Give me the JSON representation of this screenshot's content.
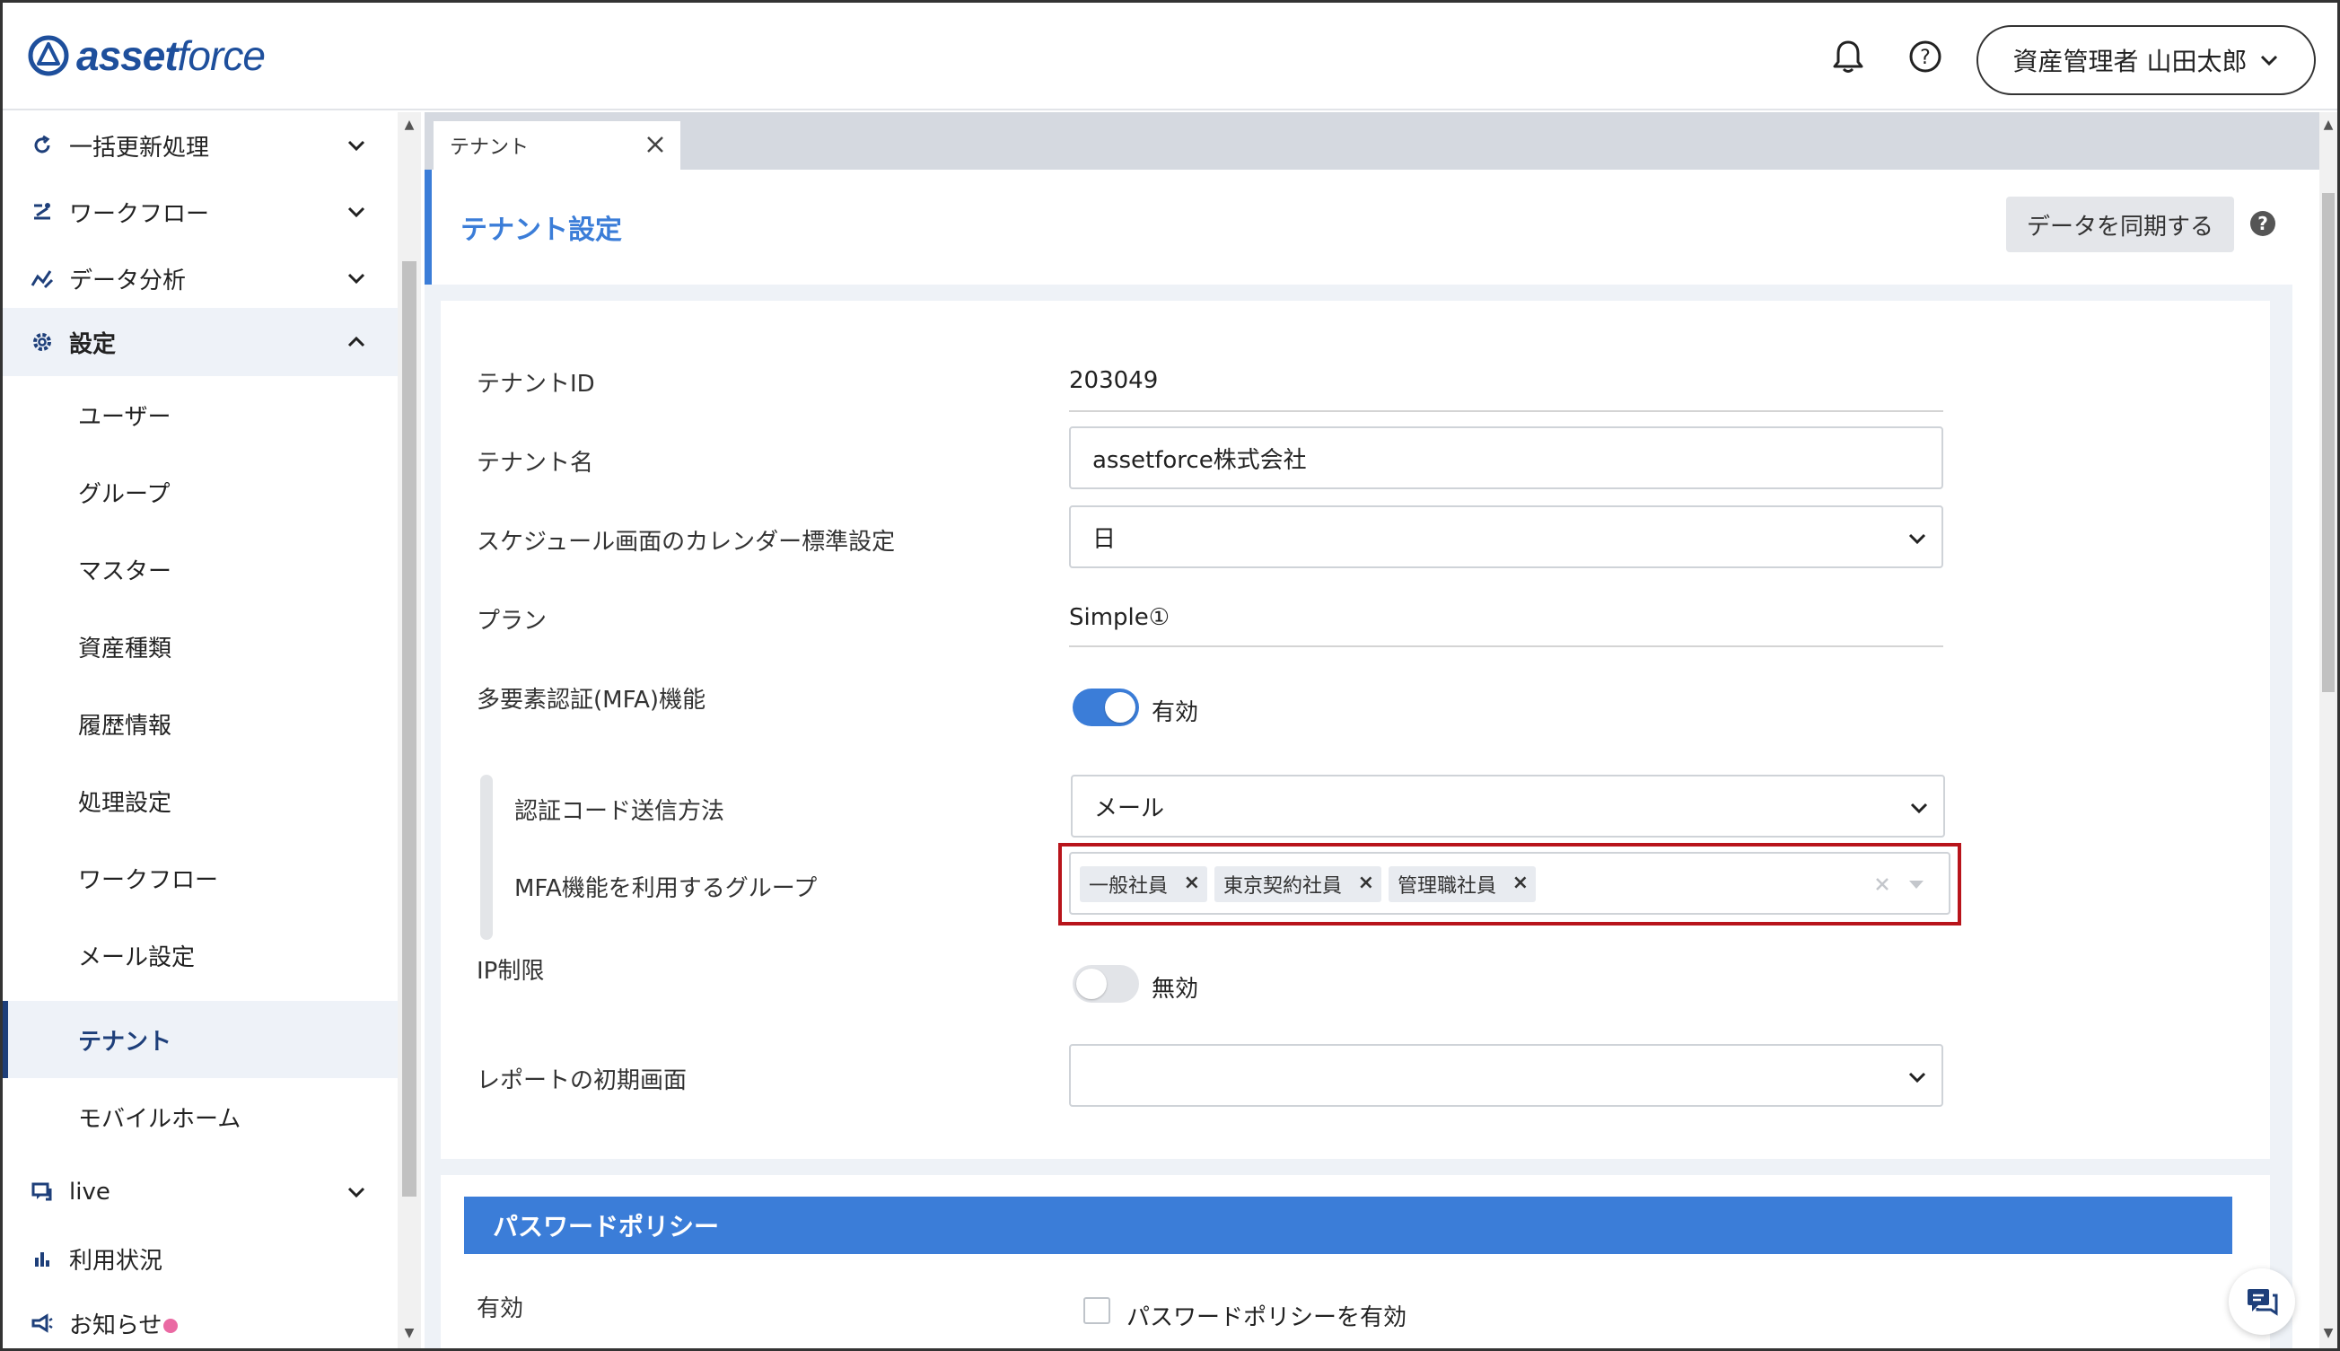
{
  "header": {
    "logo_text_bold": "asset",
    "logo_text_light": "force",
    "user_label": "資産管理者 山田太郎"
  },
  "sidebar": {
    "items": [
      {
        "label": "一括更新処理",
        "icon": "refresh-icon"
      },
      {
        "label": "ワークフロー",
        "icon": "workflow-icon"
      },
      {
        "label": "データ分析",
        "icon": "analytics-icon"
      },
      {
        "label": "設定",
        "icon": "gear-icon"
      }
    ],
    "settings_children": [
      "ユーザー",
      "グループ",
      "マスター",
      "資産種類",
      "履歴情報",
      "処理設定",
      "ワークフロー",
      "メール設定",
      "テナント",
      "モバイルホーム"
    ],
    "selected_child": "テナント",
    "bottom_items": [
      {
        "label": "live",
        "icon": "chat-icon"
      },
      {
        "label": "利用状況",
        "icon": "bar-chart-icon"
      },
      {
        "label": "お知らせ",
        "icon": "megaphone-icon"
      }
    ]
  },
  "tabs": [
    {
      "label": "テナント"
    }
  ],
  "page": {
    "title": "テナント設定",
    "sync_button": "データを同期する"
  },
  "form": {
    "tenant_id": {
      "label": "テナントID",
      "value": "203049"
    },
    "tenant_name": {
      "label": "テナント名",
      "value": "assetforce株式会社"
    },
    "calendar": {
      "label": "スケジュール画面のカレンダー標準設定",
      "value": "日"
    },
    "plan": {
      "label": "プラン",
      "value": "Simple①"
    },
    "mfa": {
      "label": "多要素認証(MFA)機能",
      "state_label": "有効",
      "enabled": true
    },
    "auth_method": {
      "label": "認証コード送信方法",
      "value": "メール"
    },
    "mfa_groups": {
      "label": "MFA機能を利用するグループ",
      "chips": [
        "一般社員",
        "東京契約社員",
        "管理職社員"
      ]
    },
    "ip_limit": {
      "label": "IP制限",
      "state_label": "無効",
      "enabled": false
    },
    "report_initial": {
      "label": "レポートの初期画面",
      "value": ""
    }
  },
  "password_policy": {
    "header": "パスワードポリシー",
    "enabled_label": "有効",
    "checkbox_label": "パスワードポリシーを有効"
  },
  "colors": {
    "accent": "#3b7dd8",
    "brand": "#1e4f9c",
    "highlight": "#b8141b",
    "notification_dot": "#ea6aa3"
  }
}
